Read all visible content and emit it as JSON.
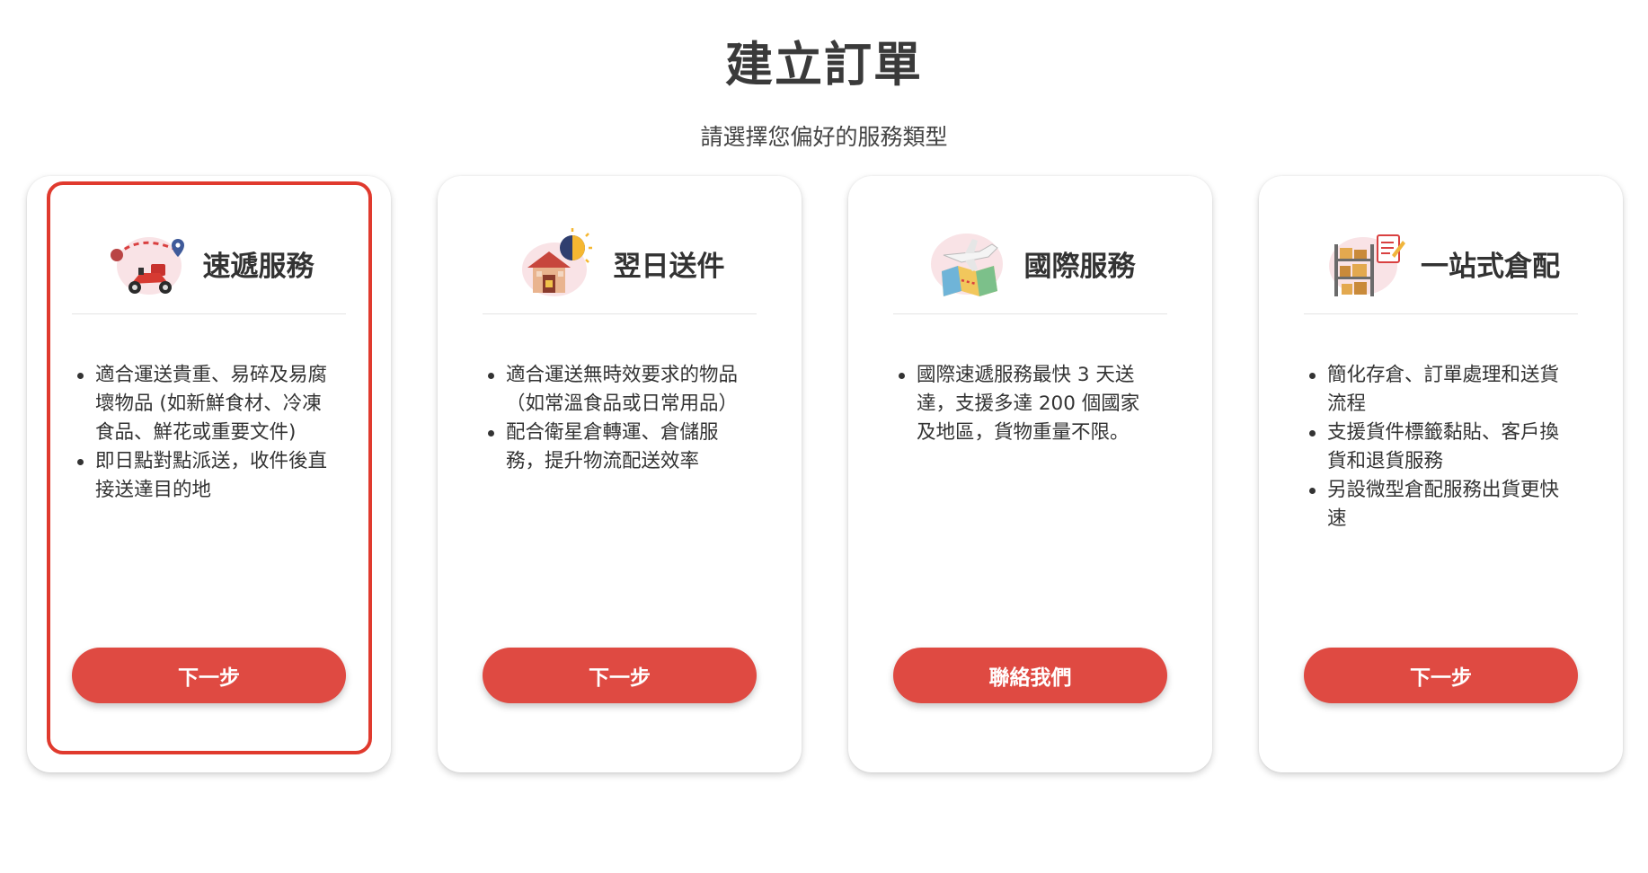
{
  "page": {
    "title": "建立訂單",
    "subtitle": "請選擇您偏好的服務類型"
  },
  "cards": [
    {
      "name": "速遞服務",
      "icon": "motorcycle-delivery-icon",
      "selected": true,
      "bullets": [
        "適合運送貴重、易碎及易腐壞物品 (如新鮮食材、冷凍食品、鮮花或重要文件)",
        "即日點對點派送，收件後直接送達目的地"
      ],
      "button_label": "下一步"
    },
    {
      "name": "翌日送件",
      "icon": "next-day-house-icon",
      "selected": false,
      "bullets": [
        "適合運送無時效要求的物品（如常溫食品或日常用品）",
        "配合衛星倉轉運、倉儲服務，提升物流配送效率"
      ],
      "button_label": "下一步"
    },
    {
      "name": "國際服務",
      "icon": "international-map-plane-icon",
      "selected": false,
      "bullets": [
        "國際速遞服務最快 3 天送達，支援多達 200 個國家及地區，貨物重量不限。"
      ],
      "button_label": "聯絡我們"
    },
    {
      "name": "一站式倉配",
      "icon": "warehouse-shelf-icon",
      "selected": false,
      "bullets": [
        "簡化存倉、訂單處理和送貨流程",
        "支援貨件標籤黏貼、客戶換貨和退貨服務",
        "另設微型倉配服務出貨更快速"
      ],
      "button_label": "下一步"
    }
  ],
  "colors": {
    "accent": "#df4a42",
    "selected_border": "#e03a2e",
    "text": "#333333"
  }
}
